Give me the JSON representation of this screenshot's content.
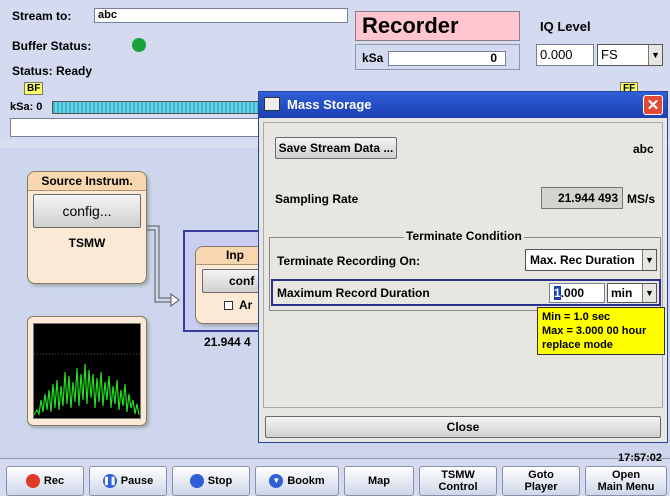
{
  "header": {
    "stream_to_label": "Stream to:",
    "stream_to_value": "abc",
    "buffer_status_label": "Buffer Status:",
    "status_text": "Status: Ready",
    "recorder_title": "Recorder",
    "ksa_label": "kSa",
    "ksa_value": "0",
    "iq_level_label": "IQ Level",
    "iq_level_value": "0.000",
    "iq_level_unit": "FS",
    "bf_tag": "BF",
    "ff_tag": "FF",
    "ksa_progress_label": "kSa: 0"
  },
  "source_panel": {
    "title": "Source Instrum.",
    "config_label": "config...",
    "device": "TSMW"
  },
  "input_panel": {
    "title": "Inp",
    "config_label": "conf",
    "checkbox_label": "Ar",
    "rate_partial": "21.944 4"
  },
  "dialog": {
    "title": "Mass Storage",
    "save_button": "Save Stream Data ...",
    "stream_name": "abc",
    "sampling_rate_label": "Sampling Rate",
    "sampling_rate_value": "21.944 493",
    "sampling_rate_unit": "MS/s",
    "terminate_group_title": "Terminate Condition",
    "terminate_on_label": "Terminate Recording On:",
    "terminate_on_value": "Max. Rec Duration",
    "max_duration_label": "Maximum Record Duration",
    "max_duration_cursor_char": "1",
    "max_duration_rest": ".000",
    "max_duration_unit": "min",
    "tooltip_lines": [
      "Min = 1.0 sec",
      "Max = 3.000 00 hour",
      "replace mode"
    ],
    "close_button": "Close"
  },
  "footer": {
    "time": "17:57:02",
    "buttons": [
      "Rec",
      "Pause",
      "Stop",
      "Bookm",
      "Map"
    ],
    "tsmw_control": [
      "TSMW",
      "Control"
    ],
    "goto_player": [
      "Goto",
      "Player"
    ],
    "open_main_menu": [
      "Open",
      "Main Menu"
    ]
  },
  "colors": {
    "recorder_bg": "#ffc6cf",
    "title_bar": "#1c3fb3",
    "status_ok": "#1aa03a",
    "tooltip": "#ffff00"
  }
}
